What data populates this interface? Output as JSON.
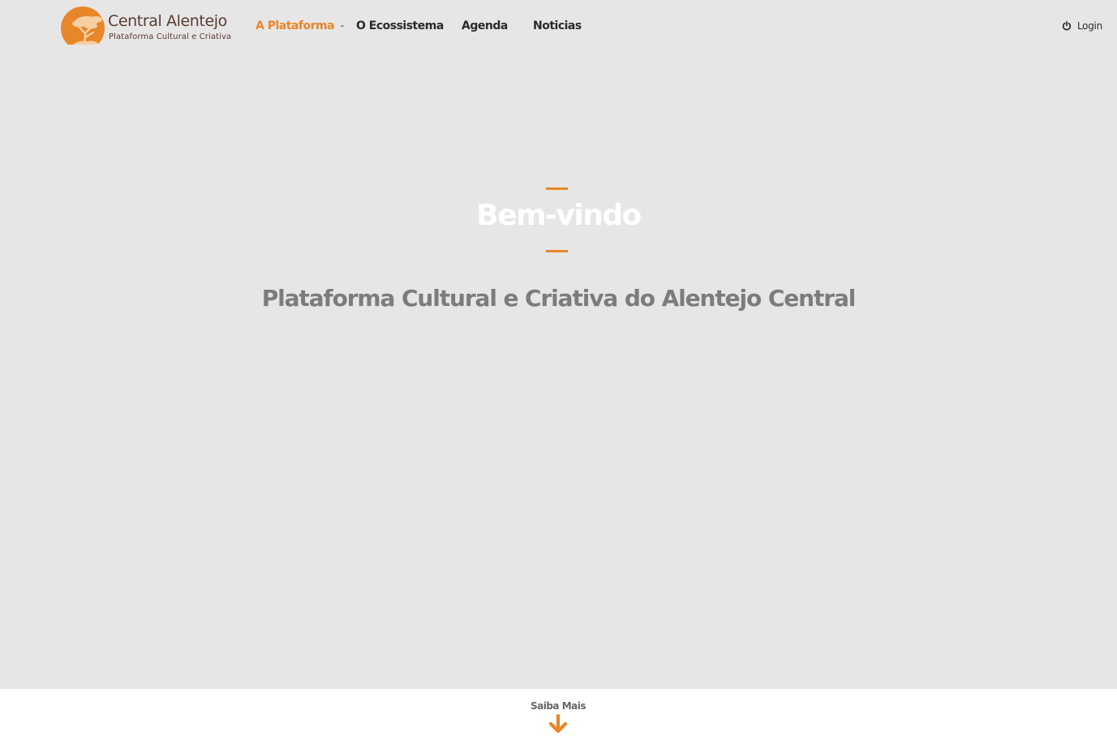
{
  "brand": {
    "name": "Central Alentejo",
    "subtitle": "Plataforma Cultural e Criativa",
    "accent_color": "#e8862a",
    "text_color": "#5a3c30",
    "logo_icon": "sun-tree-icon"
  },
  "nav": {
    "items": [
      {
        "label": "A Plataforma",
        "active": true,
        "has_dropdown": true
      },
      {
        "label": "O Ecossistema",
        "active": false,
        "has_dropdown": false
      },
      {
        "label": "Agenda",
        "active": false,
        "has_dropdown": false
      },
      {
        "label": "Noticias",
        "active": false,
        "has_dropdown": false
      }
    ],
    "login": {
      "label": "Login",
      "icon": "power-icon"
    }
  },
  "hero": {
    "heading": "Bem-vindo",
    "subheading": "Plataforma Cultural e Criativa do Alentejo Central",
    "background_color": "#e6e6e6"
  },
  "footer": {
    "more_label": "Saiba Mais",
    "more_icon": "arrow-down-icon"
  }
}
